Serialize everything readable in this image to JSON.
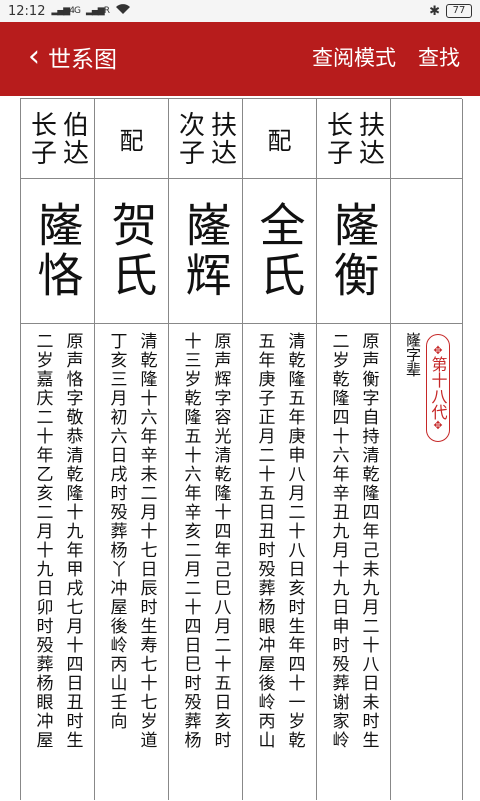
{
  "status": {
    "time": "12:12",
    "signal1": "4G",
    "signal2": "R",
    "battery": "77"
  },
  "header": {
    "title": "世系图",
    "view_mode": "查阅模式",
    "search": "查找"
  },
  "columns": [
    {
      "role": [
        "长子",
        "伯达"
      ],
      "name": "嶐恪",
      "notes": [
        "原声恪字敬恭清乾隆十九年甲戌七月十四日丑时生",
        "二岁嘉庆二十年乙亥二月十九日卯时殁葬杨眼冲屋"
      ]
    },
    {
      "role": "配",
      "name": "贺氏",
      "notes": [
        "清乾隆十六年辛未二月十七日辰时生寿七十七岁道",
        "丁亥三月初六日戌时殁葬杨丫冲屋後岭丙山壬向"
      ]
    },
    {
      "role": [
        "次子",
        "扶达"
      ],
      "name": "嶐辉",
      "notes": [
        "原声辉字容光清乾隆十四年己巳八月二十五日亥时",
        "十三岁乾隆五十六年辛亥二月二十四日巳时殁葬杨"
      ]
    },
    {
      "role": "配",
      "name": "全氏",
      "notes": [
        "清乾隆五年庚申八月二十八日亥时生年四十一岁乾",
        "五年庚子正月二十五日丑时殁葬杨眼冲屋後岭丙山"
      ]
    },
    {
      "role": [
        "长子",
        "扶达"
      ],
      "name": "嶐衡",
      "notes": [
        "原声衡字自持清乾隆四年己未九月二十八日未时生",
        "二岁乾隆四十六年辛丑九月十九日申时殁葬谢家岭"
      ]
    }
  ],
  "generation": {
    "badge": "第十八代",
    "note": "嶐字辈"
  },
  "colors": {
    "brand_red": "#b71c1c",
    "badge_red": "#c62828"
  }
}
